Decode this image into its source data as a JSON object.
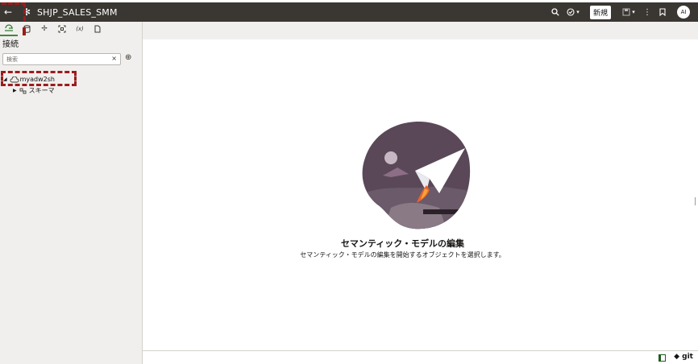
{
  "header": {
    "back_icon": "arrow-left-icon",
    "app_icon": "snowflake-icon",
    "title": "SHJP_SALES_SMM",
    "new_label": "新規",
    "avatar_label": "AI"
  },
  "sidebar": {
    "tabs": [
      "connections-icon",
      "database-icon",
      "move-icon",
      "fit-icon",
      "variable-icon",
      "document-icon"
    ],
    "variable_tab_label": "(x)",
    "section_title": "接続",
    "search": {
      "placeholder": "検索",
      "clear": "×"
    },
    "add_label": "⊕",
    "tree": [
      {
        "label": "myadw2sh",
        "expanded": true
      },
      {
        "label": "スキーマ",
        "expanded": false
      }
    ]
  },
  "main": {
    "heading": "セマンティック・モデルの編集",
    "subtext": "セマンティック・モデルの編集を開始するオブジェクトを選択します。"
  },
  "statusbar": {
    "git_label": "git"
  },
  "colors": {
    "topbar": "#3a3631",
    "sidebar_bg": "#f1efed",
    "highlight": "#9b1c1c",
    "illustration": "#5a4858"
  }
}
